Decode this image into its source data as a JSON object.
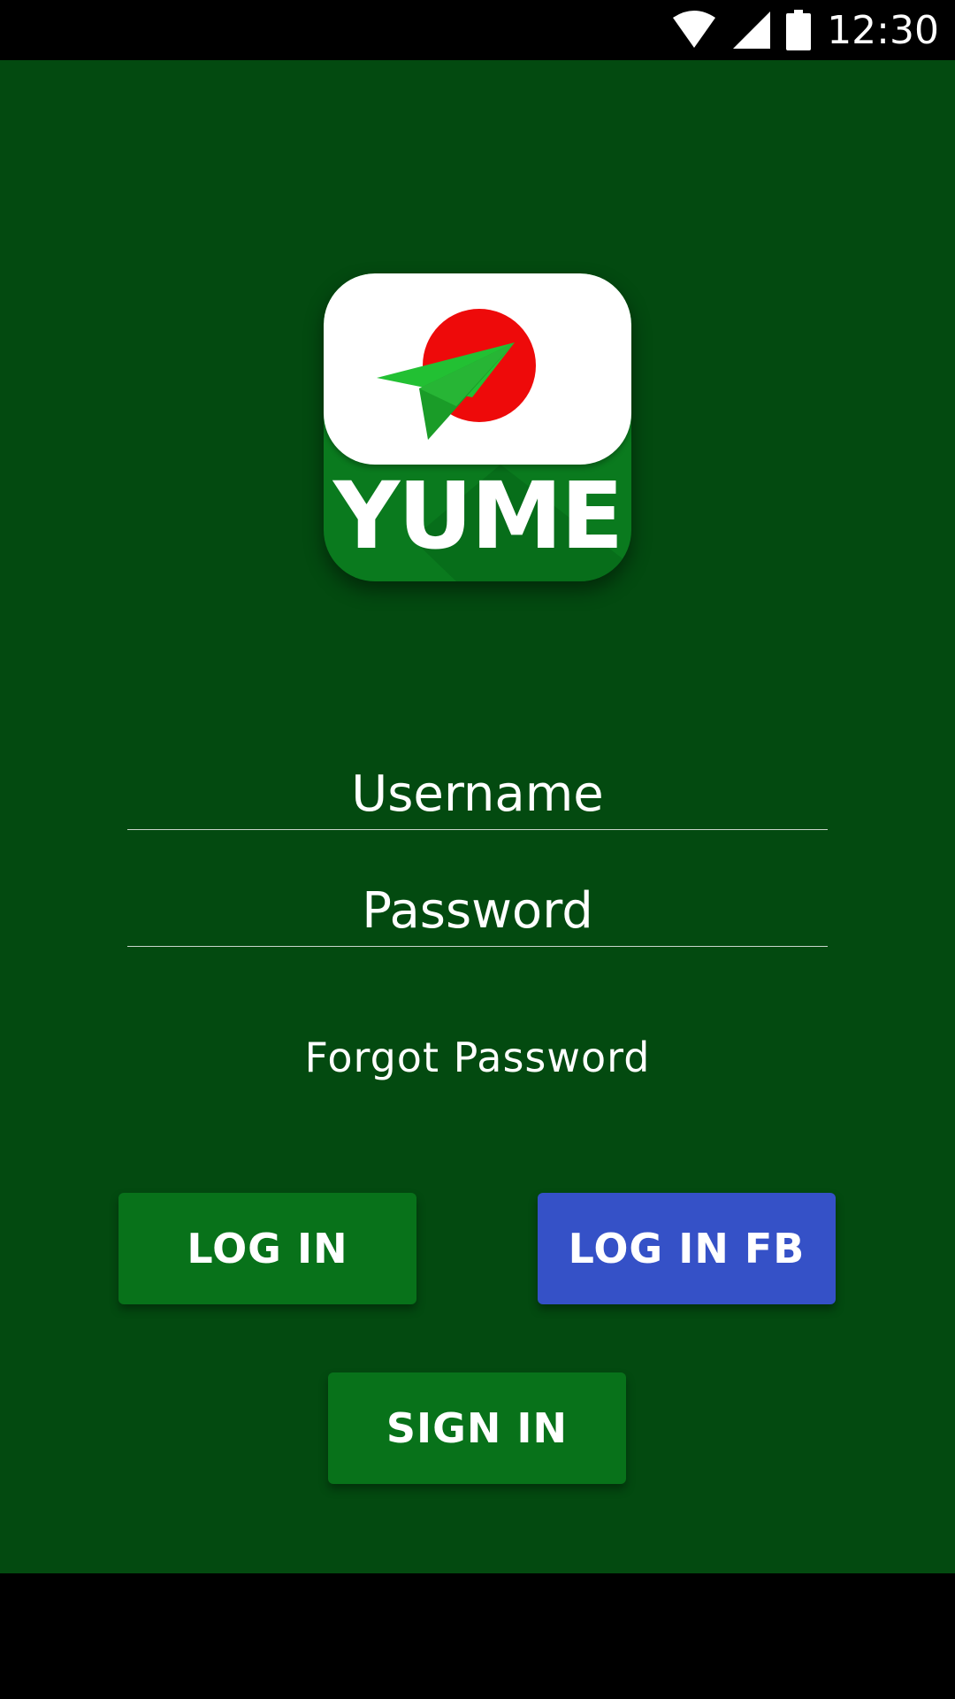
{
  "status_bar": {
    "time": "12:30",
    "icons": [
      "wifi-icon",
      "signal-icon",
      "battery-icon"
    ]
  },
  "logo": {
    "text": "YUME",
    "art": "paper-plane-sun-icon",
    "colors": {
      "top": "#ffffff",
      "bottom": "#0a7a1e",
      "sun": "#ee0a0a",
      "plane": "#22c033"
    }
  },
  "form": {
    "username_placeholder": "Username",
    "password_placeholder": "Password",
    "forgot_label": "Forgot Password"
  },
  "buttons": {
    "login_label": "LOG IN",
    "login_fb_label": "LOG IN FB",
    "signin_label": "SIGN IN"
  },
  "colors": {
    "background": "#034a10",
    "primary_button": "#08721a",
    "facebook_button": "#3551c7"
  }
}
